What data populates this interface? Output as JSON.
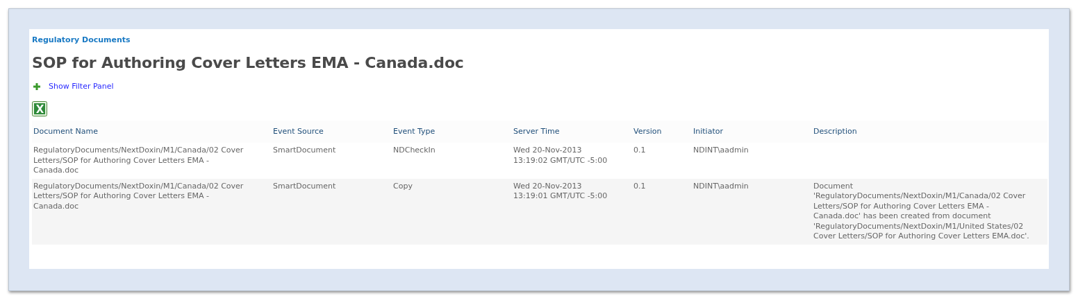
{
  "breadcrumb": "Regulatory Documents",
  "title": "SOP for Authoring Cover Letters EMA - Canada.doc",
  "filter_link": "Show Filter Panel",
  "table": {
    "columns": [
      "Document Name",
      "Event Source",
      "Event Type",
      "Server Time",
      "Version",
      "Initiator",
      "Description"
    ],
    "rows": [
      {
        "cells": [
          "RegulatoryDocuments/NextDoxin/M1/Canada/02 Cover Letters/SOP for Authoring Cover Letters EMA - Canada.doc",
          "SmartDocument",
          "NDCheckIn",
          "Wed 20-Nov-2013 13:19:02 GMT/UTC -5:00",
          "0.1",
          "NDINT\\aadmin",
          null
        ]
      },
      {
        "cells": [
          "RegulatoryDocuments/NextDoxin/M1/Canada/02 Cover Letters/SOP for Authoring Cover Letters EMA - Canada.doc",
          "SmartDocument",
          "Copy",
          "Wed 20-Nov-2013 13:19:01 GMT/UTC -5:00",
          "0.1",
          "NDINT\\aadmin",
          "Document 'RegulatoryDocuments/NextDoxin/M1/Canada/02 Cover Letters/SOP for Authoring Cover Letters EMA - Canada.doc' has been created from document 'RegulatoryDocuments/NextDoxin/M1/United States/02 Cover Letters/SOP for Authoring Cover Letters EMA.doc'."
        ]
      }
    ]
  }
}
